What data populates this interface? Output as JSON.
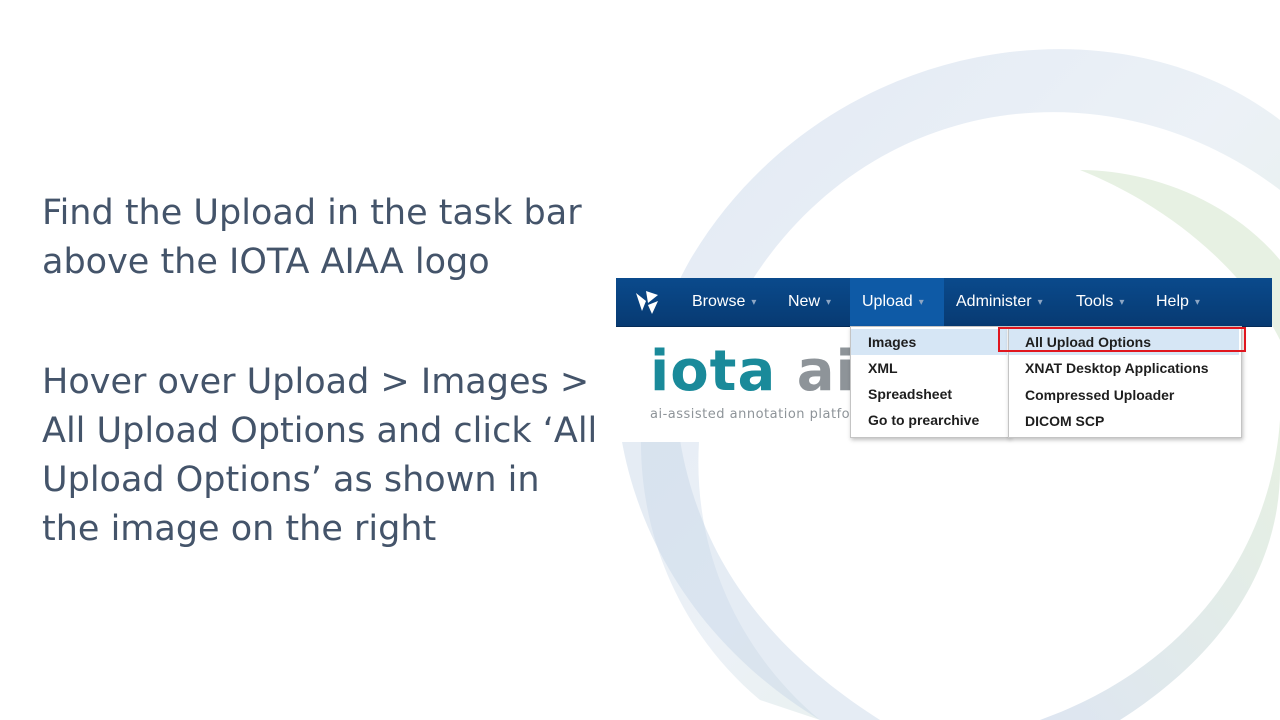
{
  "instructions": {
    "step1": "Find the Upload in the task bar above the IOTA AIAA logo",
    "step2": "Hover over Upload > Images > All Upload Options and click ‘All Upload Options’ as shown in the image on the right"
  },
  "screenshot": {
    "nav": {
      "items": [
        {
          "label": "Browse"
        },
        {
          "label": "New"
        },
        {
          "label": "Upload"
        },
        {
          "label": "Administer"
        },
        {
          "label": "Tools"
        },
        {
          "label": "Help"
        }
      ],
      "caret": "▾"
    },
    "brand": {
      "iota": "iota",
      "aiaa": "aia",
      "tagline": "ai-assisted annotation platform"
    },
    "upload_menu": {
      "items": [
        {
          "label": "Images"
        },
        {
          "label": "XML"
        },
        {
          "label": "Spreadsheet"
        },
        {
          "label": "Go to prearchive"
        }
      ]
    },
    "images_submenu": {
      "items": [
        {
          "label": "All Upload Options"
        },
        {
          "label": "XNAT Desktop Applications"
        },
        {
          "label": "Compressed Uploader"
        },
        {
          "label": "DICOM SCP"
        }
      ]
    }
  },
  "colors": {
    "text": "#44546a",
    "navbar": "#0a4a8c",
    "highlight": "#e0161e",
    "brand_teal": "#1a8a9a",
    "brand_gray": "#8e9499"
  }
}
